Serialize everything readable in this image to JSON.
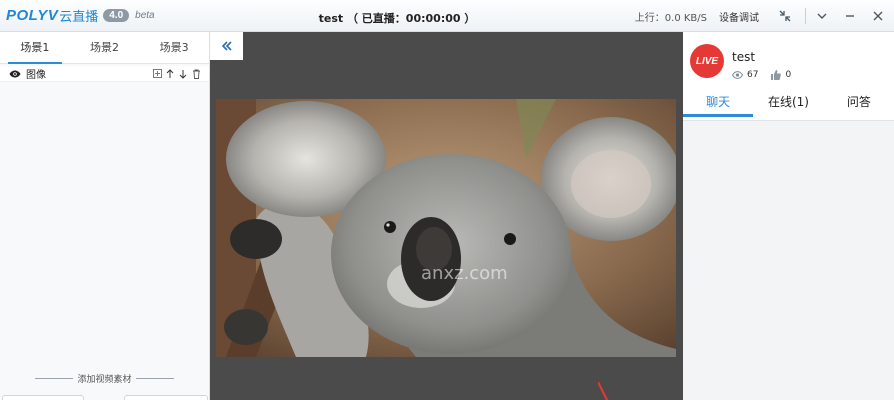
{
  "app": {
    "logo_text": "POLYV",
    "logo_cn": "云直播",
    "version": "4.0",
    "beta": "beta"
  },
  "titlebar": {
    "title": "test （ 已直播：00:00:00 ）",
    "upload": "上行：0.0 KB/S",
    "settings": "设备调试"
  },
  "scenes": {
    "tabs": [
      "场景1",
      "场景2",
      "场景3"
    ],
    "active_index": 0
  },
  "layers": [
    {
      "name": "图像",
      "visible": true
    }
  ],
  "add_source_label": "添加视频素材",
  "channel": {
    "avatar_text": "LIVE",
    "name": "test",
    "viewers": "67",
    "likes": "0"
  },
  "chat_tabs": [
    "聊天",
    "在线(1)",
    "问答"
  ],
  "chat_active_index": 0,
  "watermark": "anxz.com",
  "colors": {
    "accent": "#2b8cd8",
    "stage_bg": "#4b4b4b",
    "live_red": "#e53935"
  },
  "icons": [
    "eye-icon",
    "add-icon",
    "arrow-up-icon",
    "arrow-down-icon",
    "trash-icon",
    "collapse-left-icon",
    "shrink-icon",
    "chevron-down-icon",
    "minimize-icon",
    "close-icon",
    "view-count-icon",
    "like-icon"
  ]
}
